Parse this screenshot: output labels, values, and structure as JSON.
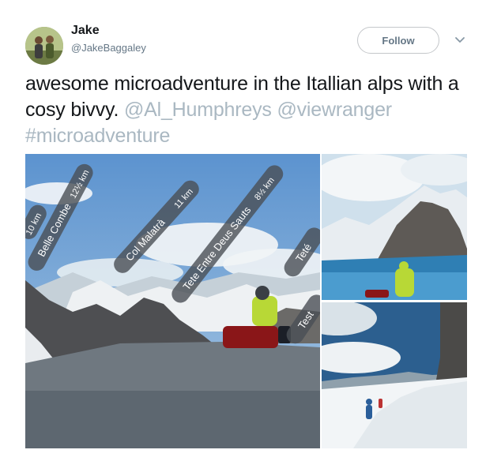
{
  "user": {
    "name": "Jake",
    "handle": "@JakeBaggaley",
    "avatar_icon": "user-avatar-photo"
  },
  "actions": {
    "follow_label": "Follow",
    "menu_icon": "chevron-down-icon"
  },
  "tweet": {
    "text": "awesome microadventure in the Itallian alps with a cosy bivvy.",
    "mentions": [
      "@Al_Humphreys",
      "@viewranger"
    ],
    "hashtag": "#microadventure"
  },
  "photo_labels": [
    {
      "name": "Belle Combe",
      "distance": "12½ km"
    },
    {
      "name": "",
      "distance": "10 km"
    },
    {
      "name": "Col Malatrà",
      "distance": "11 km"
    },
    {
      "name": "Tete Entre Deus Sauts",
      "distance": "8½ km"
    },
    {
      "name": "Teté",
      "distance": ""
    },
    {
      "name": "Test",
      "distance": ""
    }
  ],
  "colors": {
    "link": "#aab8c2",
    "text": "#14171a",
    "secondary": "#657786"
  }
}
